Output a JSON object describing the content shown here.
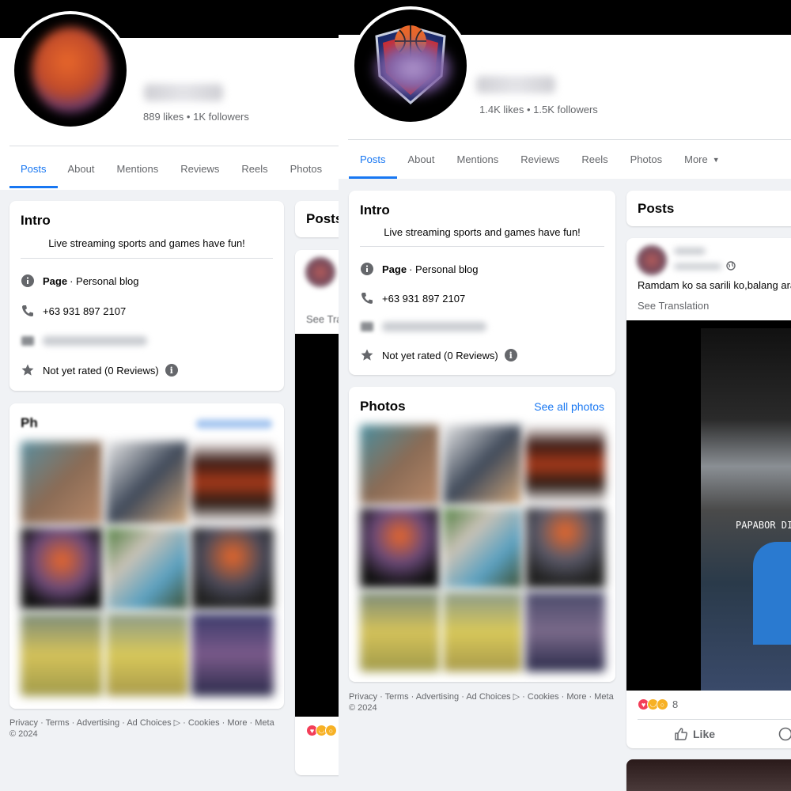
{
  "left": {
    "stats": "889 likes • 1K followers",
    "tabs": [
      "Posts",
      "About",
      "Mentions",
      "Reviews",
      "Reels",
      "Photos"
    ],
    "intro": {
      "title": "Intro",
      "bio": "Live streaming sports and games have fun!",
      "page_label": "Page",
      "page_type": " · Personal blog",
      "phone": "+63 931 897 2107",
      "rating": "Not yet rated (0 Reviews)"
    },
    "photos": {
      "title": "Ph"
    },
    "posts_title": "Posts",
    "post_snip": "See Tra",
    "footer": "Privacy · Terms · Advertising · Ad Choices ▷ · Cookies · More · Meta",
    "footer_year": "© 2024"
  },
  "right": {
    "stats": "1.4K likes • 1.5K followers",
    "tabs": [
      "Posts",
      "About",
      "Mentions",
      "Reviews",
      "Reels",
      "Photos",
      "More"
    ],
    "intro": {
      "title": "Intro",
      "bio": "Live streaming sports and games have fun!",
      "page_label": "Page",
      "page_type": " · Personal blog",
      "phone": "+63 931 897 2107",
      "rating": "Not yet rated (0 Reviews)"
    },
    "photos": {
      "title": "Photos",
      "see_all": "See all photos"
    },
    "posts": {
      "title": "Posts",
      "text": "Ramdam ko sa sarili ko,balang araw",
      "see_translation": "See Translation",
      "video_caption": "PAPABOR DIN",
      "reaction_count": "8",
      "like_label": "Like"
    },
    "footer": "Privacy · Terms · Advertising · Ad Choices ▷ · Cookies · More · Meta",
    "footer_year": "© 2024"
  },
  "colors": {
    "accent": "#1877f2",
    "muted": "#65676b",
    "page_bg": "#f0f2f5"
  },
  "icons": [
    "info-icon",
    "phone-icon",
    "email-icon",
    "star-icon",
    "globe-icon",
    "like-icon",
    "comment-icon"
  ]
}
